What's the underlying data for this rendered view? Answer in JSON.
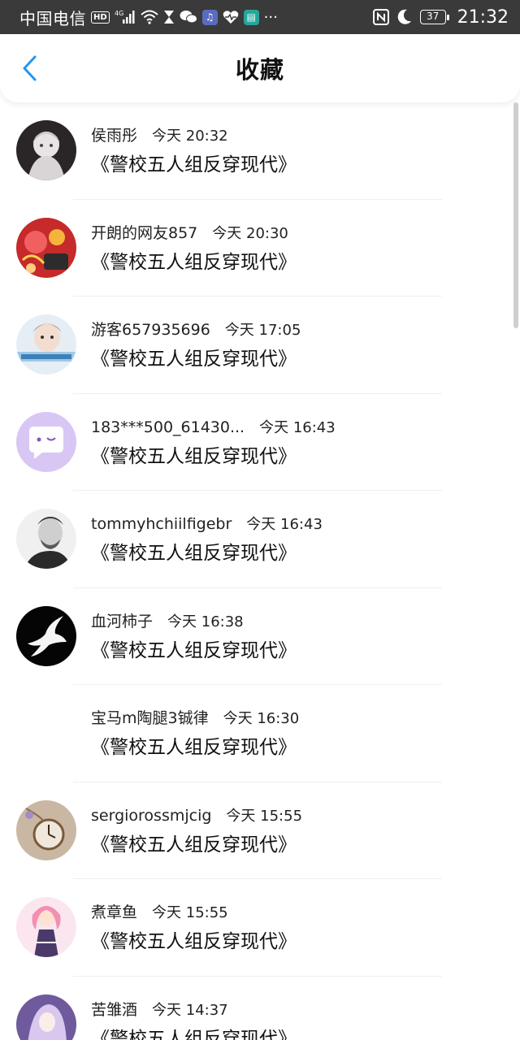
{
  "status_bar": {
    "carrier": "中国电信",
    "hd_label": "HD",
    "network": "4G",
    "time": "21:32",
    "battery": "37",
    "icons": [
      "signal-icon",
      "wifi-icon",
      "hourglass-icon",
      "wechat-icon",
      "music-app-icon",
      "health-icon",
      "reader-app-icon",
      "more-dots-icon",
      "nfc-icon",
      "moon-icon",
      "battery-icon"
    ]
  },
  "header": {
    "title": "收藏",
    "back_icon": "chevron-left-icon",
    "accent_color": "#2196f3"
  },
  "items": [
    {
      "username": "侯雨彤",
      "time": "今天 20:32",
      "book": "《警校五人组反穿现代》",
      "avatar": "anime-girl-avatar"
    },
    {
      "username": "开朗的网友857",
      "time": "今天 20:30",
      "book": "《警校五人组反穿现代》",
      "avatar": "red-festive-avatar"
    },
    {
      "username": "游客657935696",
      "time": "今天 17:05",
      "book": "《警校五人组反穿现代》",
      "avatar": "boy-portrait-avatar"
    },
    {
      "username": "183***500_61430...",
      "time": "今天 16:43",
      "book": "《警校五人组反穿现代》",
      "avatar": "default-chat-avatar"
    },
    {
      "username": "tommyhchiilfigebr",
      "time": "今天 16:43",
      "book": "《警校五人组反穿现代》",
      "avatar": "man-bw-avatar"
    },
    {
      "username": "血河柿子",
      "time": "今天 16:38",
      "book": "《警校五人组反穿现代》",
      "avatar": "dove-avatar"
    },
    {
      "username": "宝马m陶腿3铖律",
      "time": "今天 16:30",
      "book": "《警校五人组反穿现代》",
      "avatar": "no-avatar"
    },
    {
      "username": "sergiorossmjcig",
      "time": "今天 15:55",
      "book": "《警校五人组反穿现代》",
      "avatar": "pocket-watch-avatar"
    },
    {
      "username": "煮章鱼",
      "time": "今天 15:55",
      "book": "《警校五人组反穿现代》",
      "avatar": "pink-anime-avatar"
    },
    {
      "username": "苦雏酒",
      "time": "今天 14:37",
      "book": "《警校五人组反穿现代》",
      "avatar": "purple-anime-avatar"
    }
  ]
}
